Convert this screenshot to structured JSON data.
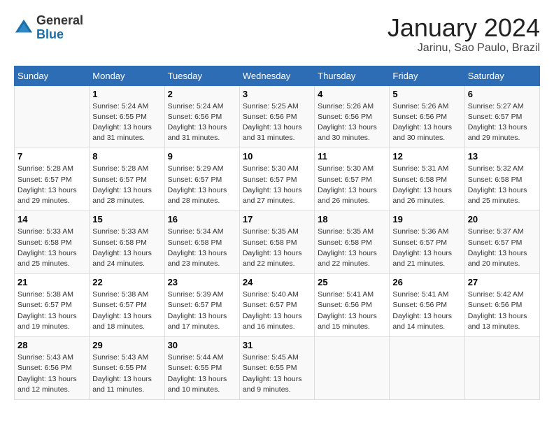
{
  "header": {
    "logo_general": "General",
    "logo_blue": "Blue",
    "month_year": "January 2024",
    "location": "Jarinu, Sao Paulo, Brazil"
  },
  "days_of_week": [
    "Sunday",
    "Monday",
    "Tuesday",
    "Wednesday",
    "Thursday",
    "Friday",
    "Saturday"
  ],
  "weeks": [
    [
      {
        "day": "",
        "sunrise": "",
        "sunset": "",
        "daylight": ""
      },
      {
        "day": "1",
        "sunrise": "Sunrise: 5:24 AM",
        "sunset": "Sunset: 6:55 PM",
        "daylight": "Daylight: 13 hours and 31 minutes."
      },
      {
        "day": "2",
        "sunrise": "Sunrise: 5:24 AM",
        "sunset": "Sunset: 6:56 PM",
        "daylight": "Daylight: 13 hours and 31 minutes."
      },
      {
        "day": "3",
        "sunrise": "Sunrise: 5:25 AM",
        "sunset": "Sunset: 6:56 PM",
        "daylight": "Daylight: 13 hours and 31 minutes."
      },
      {
        "day": "4",
        "sunrise": "Sunrise: 5:26 AM",
        "sunset": "Sunset: 6:56 PM",
        "daylight": "Daylight: 13 hours and 30 minutes."
      },
      {
        "day": "5",
        "sunrise": "Sunrise: 5:26 AM",
        "sunset": "Sunset: 6:56 PM",
        "daylight": "Daylight: 13 hours and 30 minutes."
      },
      {
        "day": "6",
        "sunrise": "Sunrise: 5:27 AM",
        "sunset": "Sunset: 6:57 PM",
        "daylight": "Daylight: 13 hours and 29 minutes."
      }
    ],
    [
      {
        "day": "7",
        "sunrise": "Sunrise: 5:28 AM",
        "sunset": "Sunset: 6:57 PM",
        "daylight": "Daylight: 13 hours and 29 minutes."
      },
      {
        "day": "8",
        "sunrise": "Sunrise: 5:28 AM",
        "sunset": "Sunset: 6:57 PM",
        "daylight": "Daylight: 13 hours and 28 minutes."
      },
      {
        "day": "9",
        "sunrise": "Sunrise: 5:29 AM",
        "sunset": "Sunset: 6:57 PM",
        "daylight": "Daylight: 13 hours and 28 minutes."
      },
      {
        "day": "10",
        "sunrise": "Sunrise: 5:30 AM",
        "sunset": "Sunset: 6:57 PM",
        "daylight": "Daylight: 13 hours and 27 minutes."
      },
      {
        "day": "11",
        "sunrise": "Sunrise: 5:30 AM",
        "sunset": "Sunset: 6:57 PM",
        "daylight": "Daylight: 13 hours and 26 minutes."
      },
      {
        "day": "12",
        "sunrise": "Sunrise: 5:31 AM",
        "sunset": "Sunset: 6:58 PM",
        "daylight": "Daylight: 13 hours and 26 minutes."
      },
      {
        "day": "13",
        "sunrise": "Sunrise: 5:32 AM",
        "sunset": "Sunset: 6:58 PM",
        "daylight": "Daylight: 13 hours and 25 minutes."
      }
    ],
    [
      {
        "day": "14",
        "sunrise": "Sunrise: 5:33 AM",
        "sunset": "Sunset: 6:58 PM",
        "daylight": "Daylight: 13 hours and 25 minutes."
      },
      {
        "day": "15",
        "sunrise": "Sunrise: 5:33 AM",
        "sunset": "Sunset: 6:58 PM",
        "daylight": "Daylight: 13 hours and 24 minutes."
      },
      {
        "day": "16",
        "sunrise": "Sunrise: 5:34 AM",
        "sunset": "Sunset: 6:58 PM",
        "daylight": "Daylight: 13 hours and 23 minutes."
      },
      {
        "day": "17",
        "sunrise": "Sunrise: 5:35 AM",
        "sunset": "Sunset: 6:58 PM",
        "daylight": "Daylight: 13 hours and 22 minutes."
      },
      {
        "day": "18",
        "sunrise": "Sunrise: 5:35 AM",
        "sunset": "Sunset: 6:58 PM",
        "daylight": "Daylight: 13 hours and 22 minutes."
      },
      {
        "day": "19",
        "sunrise": "Sunrise: 5:36 AM",
        "sunset": "Sunset: 6:57 PM",
        "daylight": "Daylight: 13 hours and 21 minutes."
      },
      {
        "day": "20",
        "sunrise": "Sunrise: 5:37 AM",
        "sunset": "Sunset: 6:57 PM",
        "daylight": "Daylight: 13 hours and 20 minutes."
      }
    ],
    [
      {
        "day": "21",
        "sunrise": "Sunrise: 5:38 AM",
        "sunset": "Sunset: 6:57 PM",
        "daylight": "Daylight: 13 hours and 19 minutes."
      },
      {
        "day": "22",
        "sunrise": "Sunrise: 5:38 AM",
        "sunset": "Sunset: 6:57 PM",
        "daylight": "Daylight: 13 hours and 18 minutes."
      },
      {
        "day": "23",
        "sunrise": "Sunrise: 5:39 AM",
        "sunset": "Sunset: 6:57 PM",
        "daylight": "Daylight: 13 hours and 17 minutes."
      },
      {
        "day": "24",
        "sunrise": "Sunrise: 5:40 AM",
        "sunset": "Sunset: 6:57 PM",
        "daylight": "Daylight: 13 hours and 16 minutes."
      },
      {
        "day": "25",
        "sunrise": "Sunrise: 5:41 AM",
        "sunset": "Sunset: 6:56 PM",
        "daylight": "Daylight: 13 hours and 15 minutes."
      },
      {
        "day": "26",
        "sunrise": "Sunrise: 5:41 AM",
        "sunset": "Sunset: 6:56 PM",
        "daylight": "Daylight: 13 hours and 14 minutes."
      },
      {
        "day": "27",
        "sunrise": "Sunrise: 5:42 AM",
        "sunset": "Sunset: 6:56 PM",
        "daylight": "Daylight: 13 hours and 13 minutes."
      }
    ],
    [
      {
        "day": "28",
        "sunrise": "Sunrise: 5:43 AM",
        "sunset": "Sunset: 6:56 PM",
        "daylight": "Daylight: 13 hours and 12 minutes."
      },
      {
        "day": "29",
        "sunrise": "Sunrise: 5:43 AM",
        "sunset": "Sunset: 6:55 PM",
        "daylight": "Daylight: 13 hours and 11 minutes."
      },
      {
        "day": "30",
        "sunrise": "Sunrise: 5:44 AM",
        "sunset": "Sunset: 6:55 PM",
        "daylight": "Daylight: 13 hours and 10 minutes."
      },
      {
        "day": "31",
        "sunrise": "Sunrise: 5:45 AM",
        "sunset": "Sunset: 6:55 PM",
        "daylight": "Daylight: 13 hours and 9 minutes."
      },
      {
        "day": "",
        "sunrise": "",
        "sunset": "",
        "daylight": ""
      },
      {
        "day": "",
        "sunrise": "",
        "sunset": "",
        "daylight": ""
      },
      {
        "day": "",
        "sunrise": "",
        "sunset": "",
        "daylight": ""
      }
    ]
  ]
}
